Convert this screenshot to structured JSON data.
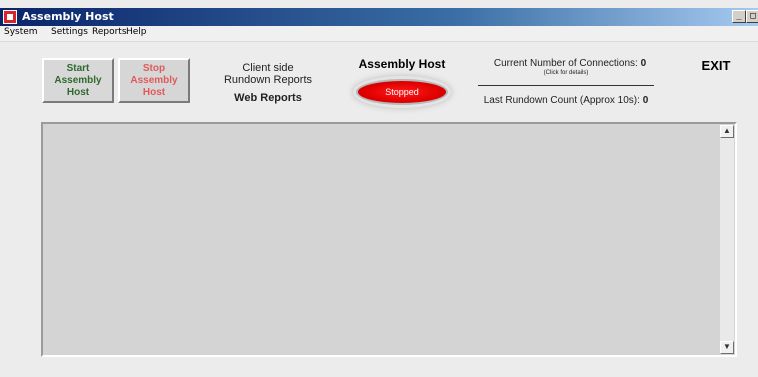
{
  "window": {
    "title": "Assembly Host",
    "controls": {
      "minimize": "_",
      "maximize": "□"
    }
  },
  "menubar": {
    "items": [
      "System",
      "Settings",
      "Reports",
      "Help"
    ]
  },
  "buttons": {
    "start": "Start\nAssembly\nHost",
    "stop": "Stop\nAssembly\nHost",
    "exit": "EXIT"
  },
  "reports": {
    "client_side": "Client side\nRundown Reports",
    "web": "Web Reports"
  },
  "status": {
    "heading": "Assembly Host",
    "state": "Stopped",
    "state_color": "#e00000"
  },
  "connections": {
    "label": "Current Number of Connections:",
    "value": "0",
    "hint": "(Click for details)"
  },
  "rundown": {
    "label": "Last Rundown Count (Approx 10s):",
    "value": "0"
  },
  "log": {
    "scroll_up": "▲",
    "scroll_down": "▼"
  }
}
